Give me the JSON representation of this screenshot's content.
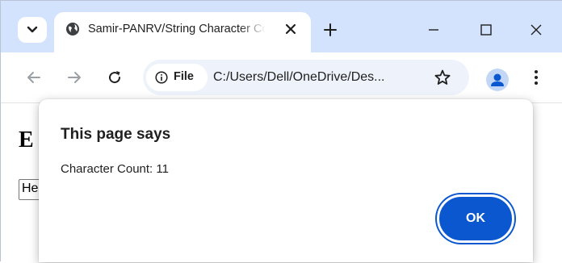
{
  "browser": {
    "tab": {
      "title": "Samir-PANRV/String Character Counter",
      "favicon": "globe-icon",
      "close_icon": "close-icon"
    },
    "tab_search_icon": "chevron-down-icon",
    "new_tab_icon": "plus-icon",
    "window_controls": [
      "minimize-icon",
      "maximize-icon",
      "close-icon"
    ],
    "toolbar": {
      "back_icon": "arrow-left-icon",
      "forward_icon": "arrow-right-icon",
      "reload_icon": "reload-icon",
      "site_info_label": "File",
      "url": "C:/Users/Dell/OneDrive/Des...",
      "bookmark_icon": "star-icon",
      "profile_icon": "person-icon",
      "menu_icon": "three-dots-icon"
    },
    "colors": {
      "tabbar_bg": "#d3e3fd",
      "omnibox_bg": "#eef3fb",
      "accent": "#0b57d0"
    }
  },
  "page": {
    "heading": "E",
    "input_value": "He"
  },
  "dialog": {
    "title": "This page says",
    "message": "Character Count: 11",
    "ok_label": "OK"
  }
}
